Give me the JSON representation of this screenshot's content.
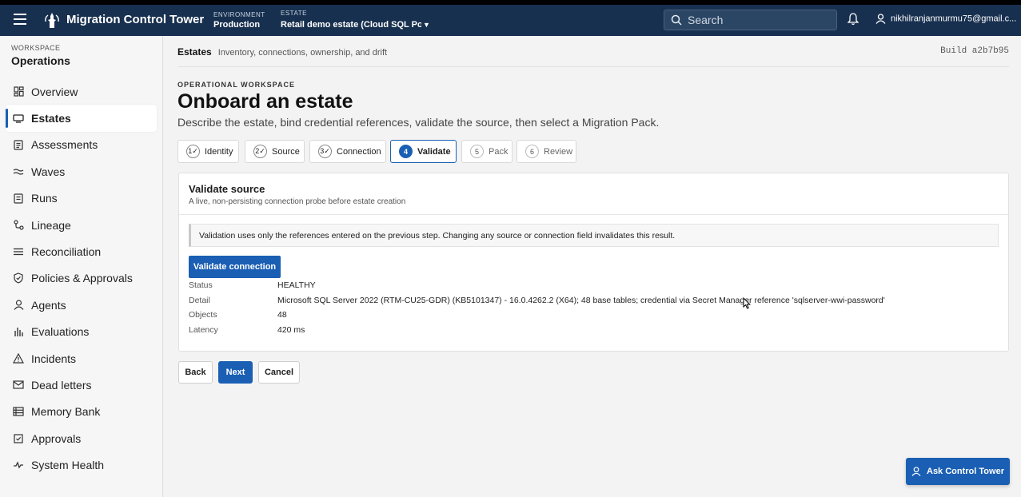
{
  "topbar": {
    "app_title": "Migration Control Tower",
    "environment_label": "ENVIRONMENT",
    "environment_value": "Production",
    "estate_label": "ESTATE",
    "estate_value": "Retail demo estate (Cloud SQL Postgres)",
    "search_placeholder": "Search",
    "user_email": "nikhilranjanmurmu75@gmail.c..."
  },
  "sidebar": {
    "workspace_label": "WORKSPACE",
    "workspace_name": "Operations",
    "items": [
      {
        "label": "Overview",
        "icon": "grid-icon"
      },
      {
        "label": "Estates",
        "icon": "database-icon",
        "active": true
      },
      {
        "label": "Assessments",
        "icon": "clipboard-icon"
      },
      {
        "label": "Waves",
        "icon": "waves-icon"
      },
      {
        "label": "Runs",
        "icon": "list-icon"
      },
      {
        "label": "Lineage",
        "icon": "lineage-icon"
      },
      {
        "label": "Reconciliation",
        "icon": "sliders-icon"
      },
      {
        "label": "Policies & Approvals",
        "icon": "shield-icon"
      },
      {
        "label": "Agents",
        "icon": "person-icon"
      },
      {
        "label": "Evaluations",
        "icon": "bar-chart-icon"
      },
      {
        "label": "Incidents",
        "icon": "warning-icon"
      },
      {
        "label": "Dead letters",
        "icon": "mail-icon"
      },
      {
        "label": "Memory Bank",
        "icon": "memory-icon"
      },
      {
        "label": "Approvals",
        "icon": "check-box-icon"
      },
      {
        "label": "System Health",
        "icon": "pulse-icon"
      }
    ]
  },
  "header": {
    "breadcrumb_title": "Estates",
    "breadcrumb_sub": "Inventory, connections, ownership, and drift",
    "build": "Build a2b7b95"
  },
  "page": {
    "eyebrow": "OPERATIONAL WORKSPACE",
    "title": "Onboard an estate",
    "subtitle": "Describe the estate, bind credential references, validate the source, then select a Migration Pack."
  },
  "steps": [
    {
      "num": "1✓",
      "label": "Identity",
      "state": "done"
    },
    {
      "num": "2✓",
      "label": "Source",
      "state": "done"
    },
    {
      "num": "3✓",
      "label": "Connection",
      "state": "done"
    },
    {
      "num": "4",
      "label": "Validate",
      "state": "active"
    },
    {
      "num": "5",
      "label": "Pack",
      "state": "pending"
    },
    {
      "num": "6",
      "label": "Review",
      "state": "pending"
    }
  ],
  "validate": {
    "title": "Validate source",
    "subtitle": "A live, non-persisting connection probe before estate creation",
    "notice": "Validation uses only the references entered on the previous step. Changing any source or connection field invalidates this result.",
    "button_label": "Validate connection",
    "results": [
      {
        "key": "Status",
        "value": "HEALTHY"
      },
      {
        "key": "Detail",
        "value": "Microsoft SQL Server 2022 (RTM-CU25-GDR) (KB5101347) - 16.0.4262.2 (X64); 48 base tables; credential via Secret Manager reference 'sqlserver-wwi-password'"
      },
      {
        "key": "Objects",
        "value": "48"
      },
      {
        "key": "Latency",
        "value": "420 ms"
      }
    ]
  },
  "actions": {
    "back": "Back",
    "next": "Next",
    "cancel": "Cancel"
  },
  "assistant": {
    "label": "Ask Control Tower"
  },
  "colors": {
    "topbar": "#18304f",
    "accent": "#1a5fb4"
  }
}
